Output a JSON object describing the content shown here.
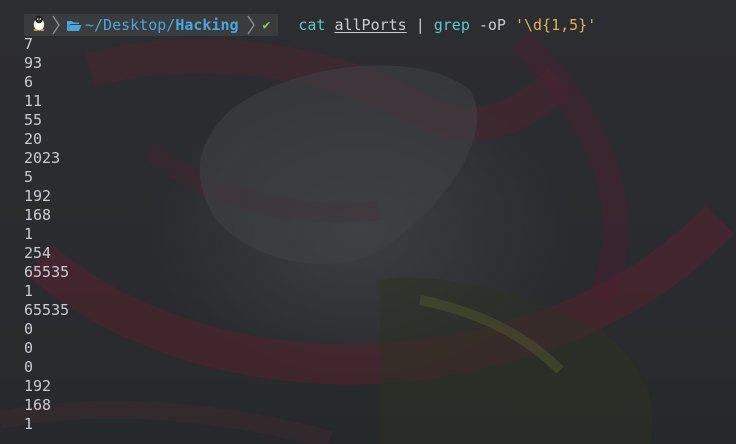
{
  "prompt": {
    "os_icon": "linux-tux-icon",
    "folder_icon": "folder-open-icon",
    "path_prefix": "~/Desktop/",
    "path_current": "Hacking",
    "status_icon": "check-mark-icon",
    "status_text": "✔"
  },
  "command": {
    "name": "cat",
    "file": "allPorts",
    "pipe": "|",
    "filter": "grep",
    "flags": "-oP",
    "pattern": "'\\d{1,5}'"
  },
  "output": [
    "7",
    "93",
    "6",
    "11",
    "55",
    "20",
    "2023",
    "5",
    "192",
    "168",
    "1",
    "254",
    "65535",
    "1",
    "65535",
    "0",
    "0",
    "0",
    "192",
    "168",
    "1"
  ],
  "colors": {
    "prompt_segment_bg": "#3a3b3d",
    "path": "#4aa5dd",
    "status_ok": "#8ecb3f",
    "command": "#5fc7c9",
    "string": "#e3b05b",
    "text": "#c9ccd2"
  }
}
